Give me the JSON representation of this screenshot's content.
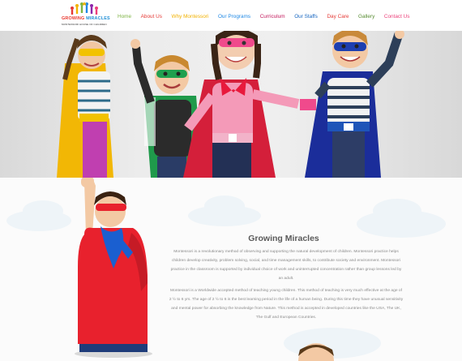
{
  "logo": {
    "title_word1": "GROWING",
    "title_word2": "MIRACLES",
    "subtitle": "MONTESSORI HOUSE OF CHILDREN"
  },
  "nav": {
    "items": [
      {
        "label": "Home",
        "color": "#7cb342"
      },
      {
        "label": "About Us",
        "color": "#e53935"
      },
      {
        "label": "Why Montessori",
        "color": "#f2b200"
      },
      {
        "label": "Our Programs",
        "color": "#1e88e5"
      },
      {
        "label": "Curriculum",
        "color": "#c2185b"
      },
      {
        "label": "Our Staffs",
        "color": "#1565c0"
      },
      {
        "label": "Day Care",
        "color": "#e53935"
      },
      {
        "label": "Gallery",
        "color": "#558b2f"
      },
      {
        "label": "Contact Us",
        "color": "#ec407a"
      }
    ]
  },
  "section": {
    "title": "Growing Miracles",
    "paragraph1": "Montessori is a revolutionary method of observing and supporting the natural development of children. Montessori practice helps children develop creativity, problem solving, social, and time management skills, to contribute society and environment. Montessori practice in the classroom is supported by individual choice of work and uninterrupted concentration rather than group lessons led by an adult.",
    "paragraph2": "Montessori is a Worldwide accepted method of teaching young children. This method of teaching is very much effective at the age of 2 ½ to 6 yrs. The age of 2 ½ to 6 is the best learning period in the life of a human being. During this time they have unusual sensitivity and mental power for absorbing the knowledge from Nature. This method is accepted in developed countries like the USA, The UK, The Gulf and European Countries."
  }
}
